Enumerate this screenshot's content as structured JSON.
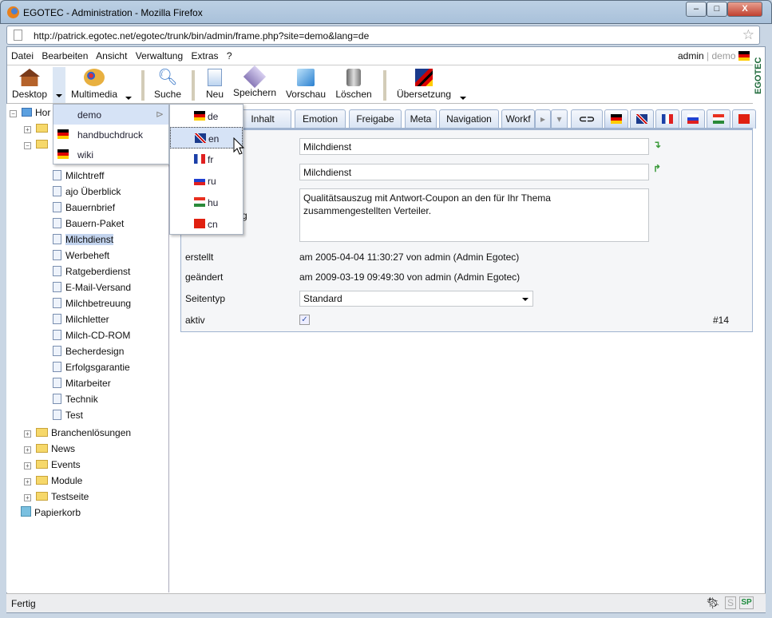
{
  "window": {
    "title": "EGOTEC - Administration - Mozilla Firefox",
    "minimize": "–",
    "maximize": "□",
    "close": "X"
  },
  "browser": {
    "url": "http://patrick.egotec.net/egotec/trunk/bin/admin/frame.php?site=demo&lang=de",
    "status": "Fertig"
  },
  "menubar": {
    "items": [
      "Datei",
      "Bearbeiten",
      "Ansicht",
      "Verwaltung",
      "Extras",
      "?"
    ],
    "user": "admin",
    "separator": "|",
    "site": "demo"
  },
  "logo": "EGOTEC",
  "toolbar": {
    "desktop": "Desktop",
    "multimedia": "Multimedia",
    "suche": "Suche",
    "neu": "Neu",
    "speichern": "Speichern",
    "vorschau": "Vorschau",
    "loeschen": "Löschen",
    "uebersetzung": "Übersetzung"
  },
  "site_menu": {
    "items": [
      {
        "label": "demo",
        "has_submenu": true,
        "highlighted": true
      },
      {
        "label": "handbuchdruck"
      },
      {
        "label": "wiki"
      }
    ]
  },
  "lang_menu": {
    "items": [
      {
        "code": "de",
        "flag": "de"
      },
      {
        "code": "en",
        "flag": "en",
        "highlighted": true
      },
      {
        "code": "fr",
        "flag": "fr"
      },
      {
        "code": "ru",
        "flag": "ru"
      },
      {
        "code": "hu",
        "flag": "hu"
      },
      {
        "code": "cn",
        "flag": "cn"
      }
    ]
  },
  "tree": {
    "root": "Hor",
    "pages": [
      "Milchtreff",
      "ajo Überblick",
      "Bauernbrief",
      "Bauern-Paket",
      "Milchdienst",
      "Werbeheft",
      "Ratgeberdienst",
      "E-Mail-Versand",
      "Milchbetreuung",
      "Milchletter",
      "Milch-CD-ROM",
      "Becherdesign",
      "Erfolgsgarantie",
      "Mitarbeiter",
      "Technik",
      "Test"
    ],
    "selected": "Milchdienst",
    "folders": [
      "Branchenlösungen",
      "News",
      "Events",
      "Module",
      "Testseite"
    ],
    "trash": "Papierkorb"
  },
  "tabs": {
    "first_partial": "n",
    "items": [
      "Inhalt",
      "Emotion",
      "Freigabe",
      "Meta",
      "Navigation",
      "Workf"
    ],
    "active_flag": "de"
  },
  "form": {
    "field1": "Milchdienst",
    "field2": "Milchdienst",
    "desc_label_partial": "bung",
    "description": "Qualitätsauszug mit Antwort-Coupon an den für Ihr Thema zusammengestellten Verteiler.",
    "erstellt_label": "erstellt",
    "erstellt": "am 2005-04-04 11:30:27 von admin (Admin Egotec)",
    "geaendert_label": "geändert",
    "geaendert": "am 2009-03-19 09:49:30 von admin (Admin Egotec)",
    "seitentyp_label": "Seitentyp",
    "seitentyp": "Standard",
    "aktiv_label": "aktiv",
    "aktiv": true,
    "id": "#14"
  },
  "statusbar": {
    "s": "S",
    "sp": "SP"
  }
}
